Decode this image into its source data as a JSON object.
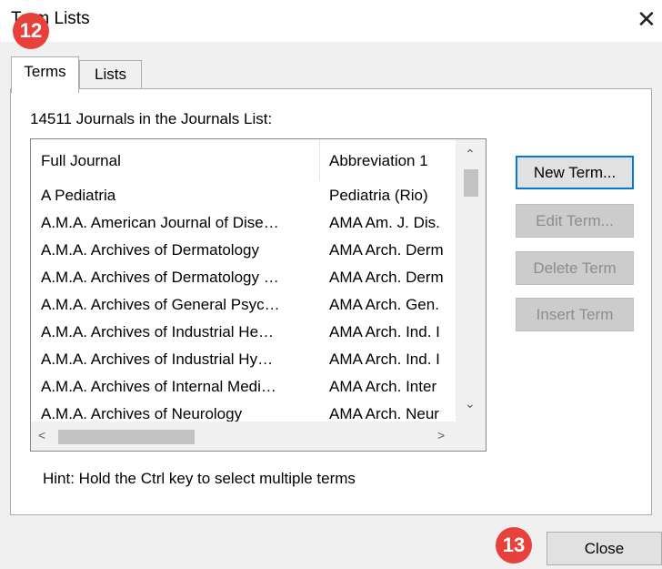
{
  "window": {
    "title": "Term Lists",
    "close_glyph": "✕"
  },
  "tabs": [
    {
      "label": "Terms",
      "selected": true
    },
    {
      "label": "Lists",
      "selected": false
    }
  ],
  "count_label": "14511 Journals in the Journals List:",
  "table": {
    "columns": [
      "Full Journal",
      "Abbreviation 1"
    ],
    "rows": [
      [
        "A Pediatria",
        "Pediatria (Rio)"
      ],
      [
        "A.M.A. American Journal of Dise…",
        "AMA Am. J. Dis."
      ],
      [
        "A.M.A. Archives of Dermatology",
        "AMA Arch. Derm"
      ],
      [
        "A.M.A. Archives of Dermatology …",
        "AMA Arch. Derm"
      ],
      [
        "A.M.A. Archives of General Psyc…",
        "AMA Arch. Gen."
      ],
      [
        "A.M.A. Archives of Industrial He…",
        "AMA Arch. Ind. I"
      ],
      [
        "A.M.A. Archives of Industrial Hy…",
        "AMA Arch. Ind. I"
      ],
      [
        "A.M.A. Archives of Internal Medi…",
        "AMA Arch. Inter"
      ],
      [
        "A.M.A. Archives of Neurology",
        "AMA Arch. Neur"
      ]
    ]
  },
  "buttons": {
    "new_term": "New Term...",
    "edit_term": "Edit Term...",
    "delete_term": "Delete Term",
    "insert_term": "Insert Term",
    "close": "Close"
  },
  "hint": "Hint: Hold the Ctrl key to select multiple terms",
  "badges": {
    "tabs": "12",
    "close": "13"
  },
  "icons": {
    "scroll_up": "⌃",
    "scroll_down": "⌄",
    "scroll_left": "<",
    "scroll_right": ">"
  },
  "colors": {
    "badge": "#e8403a",
    "focus_border": "#0078d7",
    "disabled_text": "#8d8d8d"
  }
}
